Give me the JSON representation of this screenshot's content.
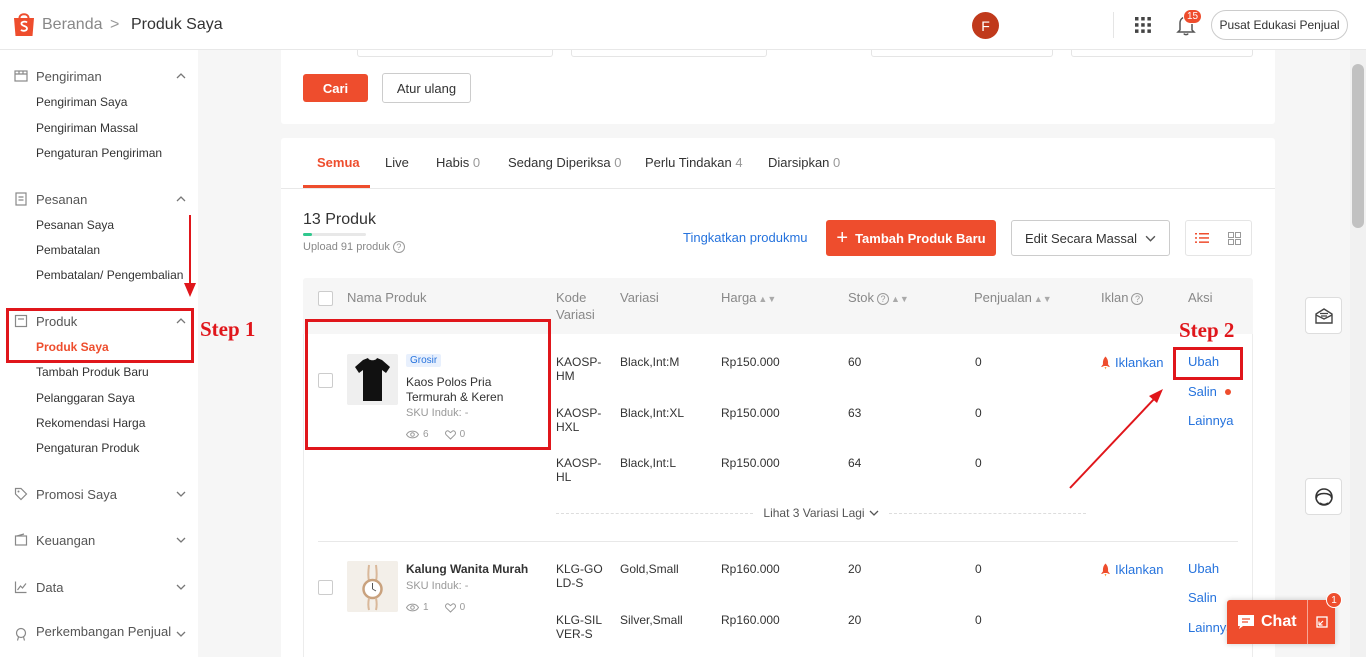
{
  "header": {
    "breadcrumb_home": "Beranda",
    "breadcrumb_sep": ">",
    "breadcrumb_current": "Produk Saya",
    "avatar_initial": "F",
    "notification_count": "15",
    "edu_button": "Pusat Edukasi Penjual",
    "brand_color": "#ee4d2d"
  },
  "sidebar": {
    "sections": [
      {
        "title": "Pengiriman",
        "icon": "truck-icon",
        "items": [
          "Pengiriman Saya",
          "Pengiriman Massal",
          "Pengaturan Pengiriman"
        ]
      },
      {
        "title": "Pesanan",
        "icon": "clipboard-icon",
        "items": [
          "Pesanan Saya",
          "Pembatalan",
          "Pembatalan/ Pengembalian"
        ]
      },
      {
        "title": "Produk",
        "icon": "box-icon",
        "items": [
          "Produk Saya",
          "Tambah Produk Baru",
          "Pelanggaran Saya",
          "Rekomendasi Harga",
          "Pengaturan Produk"
        ]
      },
      {
        "title": "Promosi Saya",
        "icon": "tag-icon"
      },
      {
        "title": "Keuangan",
        "icon": "wallet-icon"
      },
      {
        "title": "Data",
        "icon": "chart-icon"
      },
      {
        "title": "Perkembangan Penjual",
        "icon": "medal-icon"
      }
    ],
    "active_item": "Produk Saya"
  },
  "filters": {
    "search_button": "Cari",
    "reset_button": "Atur ulang"
  },
  "tabs": [
    {
      "label": "Semua",
      "count": ""
    },
    {
      "label": "Live",
      "count": ""
    },
    {
      "label": "Habis",
      "count": "0"
    },
    {
      "label": "Sedang Diperiksa",
      "count": "0"
    },
    {
      "label": "Perlu Tindakan",
      "count": "4"
    },
    {
      "label": "Diarsipkan",
      "count": "0"
    }
  ],
  "toolbar": {
    "product_count": "13 Produk",
    "upload_progress": 0.14,
    "upload_text": "Upload 91 produk",
    "upgrade_link": "Tingkatkan produkmu",
    "add_button": "Tambah Produk Baru",
    "mass_edit_button": "Edit Secara Massal"
  },
  "table": {
    "headers": {
      "name": "Nama Produk",
      "code": "Kode Variasi",
      "variation": "Variasi",
      "price": "Harga",
      "stock": "Stok",
      "sales": "Penjualan",
      "ads": "Iklan",
      "actions": "Aksi"
    },
    "products": [
      {
        "badge": "Grosir",
        "name": "Kaos Polos Pria Termurah & Keren",
        "sku": "SKU Induk: -",
        "views": "6",
        "likes": "0",
        "ad_label": "Iklankan",
        "variants": [
          {
            "code": "KAOSP-HM",
            "variation": "Black,Int:M",
            "price": "Rp150.000",
            "stock": "60",
            "sales": "0"
          },
          {
            "code": "KAOSP-HXL",
            "variation": "Black,Int:XL",
            "price": "Rp150.000",
            "stock": "63",
            "sales": "0"
          },
          {
            "code": "KAOSP-HL",
            "variation": "Black,Int:L",
            "price": "Rp150.000",
            "stock": "64",
            "sales": "0"
          }
        ],
        "more_variants": "Lihat 3 Variasi Lagi",
        "actions": [
          "Ubah",
          "Salin",
          "Lainnya"
        ]
      },
      {
        "badge": "",
        "name": "Kalung Wanita Murah",
        "sku": "SKU Induk: -",
        "views": "1",
        "likes": "0",
        "ad_label": "Iklankan",
        "variants": [
          {
            "code": "KLG-GOLD-S",
            "variation": "Gold,Small",
            "price": "Rp160.000",
            "stock": "20",
            "sales": "0"
          },
          {
            "code": "KLG-SILVER-S",
            "variation": "Silver,Small",
            "price": "Rp160.000",
            "stock": "20",
            "sales": "0"
          }
        ],
        "actions": [
          "Ubah",
          "Salin",
          "Lainnya"
        ]
      }
    ]
  },
  "annotations": {
    "step1": "Step 1",
    "step2": "Step 2",
    "color": "#e0161b"
  },
  "chat": {
    "label": "Chat",
    "badge": "1"
  }
}
